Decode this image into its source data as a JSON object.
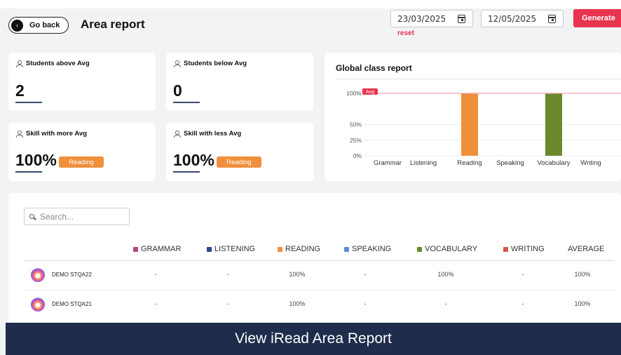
{
  "header": {
    "go_back_label": "Go back",
    "go_back_glyph": "‹",
    "title": "Area report",
    "date_from": "23/03/2025",
    "date_to": "12/05/2025",
    "reset_label": "reset",
    "generate_label": "Generate"
  },
  "stats": {
    "above_avg": {
      "label": "Students above Avg",
      "value": "2"
    },
    "below_avg": {
      "label": "Students below Avg",
      "value": "0"
    },
    "more_avg": {
      "label": "Skill with more Avg",
      "value": "100%",
      "badge": "Reading"
    },
    "less_avg": {
      "label": "Skill with less Avg",
      "value": "100%",
      "badge": "Reading"
    }
  },
  "chart_data": {
    "type": "bar",
    "title": "Global class report",
    "categories": [
      "Grammar",
      "Listening",
      "Reading",
      "Speaking",
      "Vocabulary",
      "Writing"
    ],
    "values": [
      0,
      0,
      100,
      0,
      100,
      0
    ],
    "colors": [
      "#b04a7e",
      "#254a8a",
      "#f08f3c",
      "#5b8fd6",
      "#6a8a2c",
      "#d9544d"
    ],
    "yticks": [
      "0%",
      "25%",
      "50%",
      "100%"
    ],
    "ylim": [
      0,
      100
    ],
    "avg_label": "Avg",
    "avg_value": 100
  },
  "search": {
    "placeholder": "Search..."
  },
  "table": {
    "columns": [
      {
        "label": "GRAMMAR",
        "color": "#b04a7e"
      },
      {
        "label": "LISTENING",
        "color": "#254a8a"
      },
      {
        "label": "READING",
        "color": "#f08f3c"
      },
      {
        "label": "SPEAKING",
        "color": "#5b8fd6"
      },
      {
        "label": "VOCABULARY",
        "color": "#6a8a2c"
      },
      {
        "label": "WRITING",
        "color": "#d9544d"
      },
      {
        "label": "AVERAGE",
        "color": ""
      }
    ],
    "rows": [
      {
        "name": "DEMO STQA22",
        "values": [
          "-",
          "-",
          "100%",
          "-",
          "100%",
          "-",
          "100%"
        ]
      },
      {
        "name": "DEMO STQA21",
        "values": [
          "-",
          "-",
          "100%",
          "-",
          "-",
          "-",
          "100%"
        ]
      }
    ]
  },
  "banner": {
    "text": "View iRead Area Report"
  }
}
